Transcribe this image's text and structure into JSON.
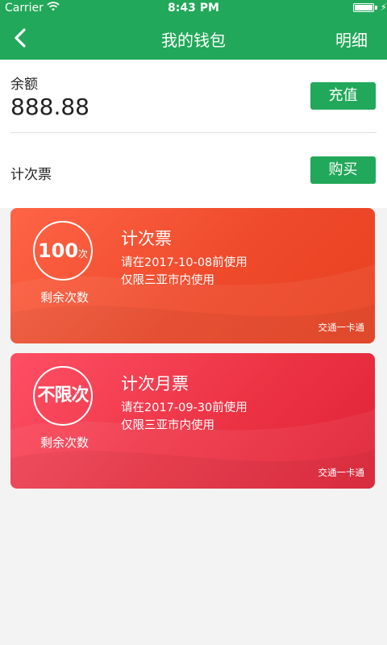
{
  "status_bar": {
    "carrier": "Carrier",
    "time": "8:43 PM",
    "battery_level": 1.0
  },
  "nav": {
    "title": "我的钱包",
    "detail": "明细",
    "back_icon": "chevron-left-icon"
  },
  "wallet": {
    "balance_label": "余额",
    "balance_value": "888.88",
    "recharge_button": "充值",
    "ticket_label": "计次票",
    "buy_button": "购买"
  },
  "cards": [
    {
      "count": "100",
      "unit": "次",
      "remaining_label": "剩余次数",
      "title": "计次票",
      "valid_until": "请在2017-10-08前使用",
      "region": "仅限三亚市内使用",
      "issuer": "交通一卡通",
      "color": "#ee4a2b"
    },
    {
      "count": "不限次",
      "remaining_label": "剩余次数",
      "title": "计次月票",
      "valid_until": "请在2017-09-30前使用",
      "region": "仅限三亚市内使用",
      "issuer": "交通一卡通",
      "color": "#ec3445"
    }
  ]
}
